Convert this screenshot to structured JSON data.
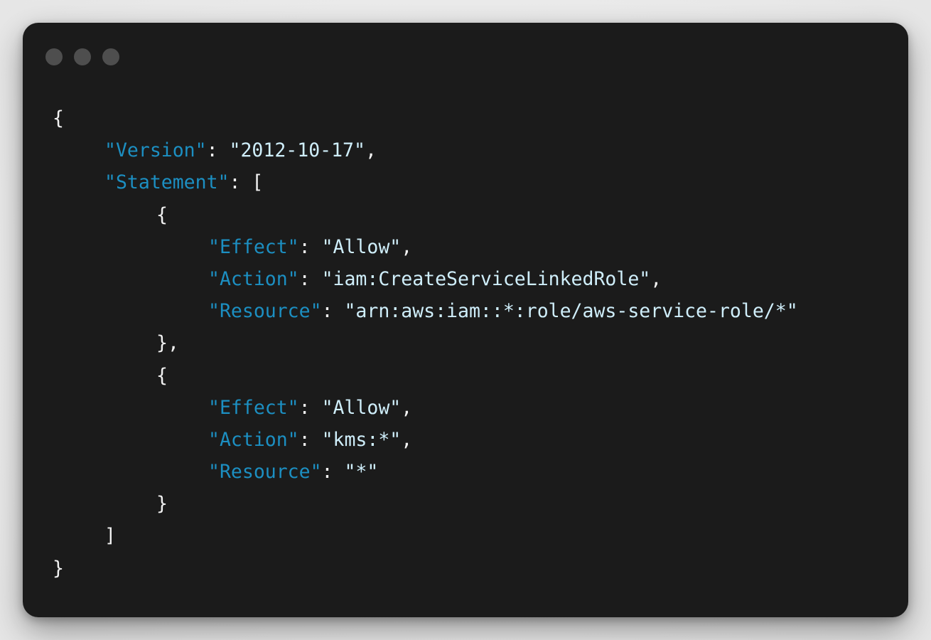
{
  "window": {
    "controls": [
      "close",
      "minimize",
      "zoom"
    ]
  },
  "colors": {
    "background": "#1b1b1b",
    "key": "#1c8fc2",
    "string": "#cfeefa",
    "punctuation": "#f2f2f2",
    "window_dot": "#4e4e4e"
  },
  "code": {
    "open_brace": "{",
    "version_key": "\"Version\"",
    "version_value": "\"2012-10-17\"",
    "statement_key": "\"Statement\"",
    "statement_open": "[",
    "statements": [
      {
        "open": "{",
        "effect_key": "\"Effect\"",
        "effect_value": "\"Allow\"",
        "action_key": "\"Action\"",
        "action_value": "\"iam:CreateServiceLinkedRole\"",
        "resource_key": "\"Resource\"",
        "resource_value": "\"arn:aws:iam::*:role/aws-service-role/*\"",
        "close": "},"
      },
      {
        "open": "{",
        "effect_key": "\"Effect\"",
        "effect_value": "\"Allow\"",
        "action_key": "\"Action\"",
        "action_value": "\"kms:*\"",
        "resource_key": "\"Resource\"",
        "resource_value": "\"*\"",
        "close": "}"
      }
    ],
    "statement_close": "]",
    "close_brace": "}"
  }
}
